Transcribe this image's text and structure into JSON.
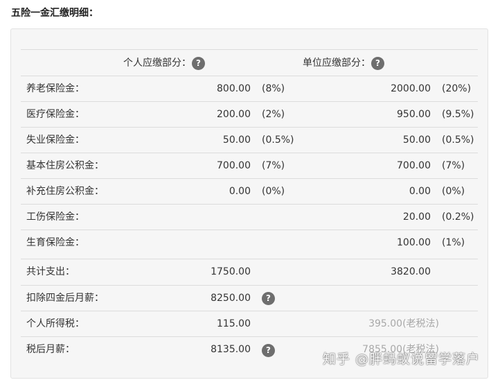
{
  "title": "五险一金汇缴明细：",
  "header": {
    "personal_label": "个人应缴部分：",
    "employer_label": "单位应缴部分：",
    "help_glyph": "?"
  },
  "rows": [
    {
      "label": "养老保险金：",
      "p_amount": "800.00",
      "p_rate": "(8%)",
      "e_amount": "2000.00",
      "e_rate": "(20%)"
    },
    {
      "label": "医疗保险金：",
      "p_amount": "200.00",
      "p_rate": "(2%)",
      "e_amount": "950.00",
      "e_rate": "(9.5%)"
    },
    {
      "label": "失业保险金：",
      "p_amount": "50.00",
      "p_rate": "(0.5%)",
      "e_amount": "50.00",
      "e_rate": "(0.5%)"
    },
    {
      "label": "基本住房公积金：",
      "p_amount": "700.00",
      "p_rate": "(7%)",
      "e_amount": "700.00",
      "e_rate": "(7%)"
    },
    {
      "label": "补充住房公积金：",
      "p_amount": "0.00",
      "p_rate": "(0%)",
      "e_amount": "0.00",
      "e_rate": "(0%)"
    },
    {
      "label": "工伤保险金：",
      "p_amount": "",
      "p_rate": "",
      "e_amount": "20.00",
      "e_rate": "(0.2%)"
    },
    {
      "label": "生育保险金：",
      "p_amount": "",
      "p_rate": "",
      "e_amount": "100.00",
      "e_rate": "(1%)"
    }
  ],
  "summary": {
    "total_label": "共计支出：",
    "total_personal": "1750.00",
    "total_employer": "3820.00",
    "after_four_label": "扣除四金后月薪：",
    "after_four_value": "8250.00",
    "income_tax_label": "个人所得税：",
    "income_tax_value": "115.00",
    "income_tax_old": "395.00(老税法)",
    "net_salary_label": "税后月薪：",
    "net_salary_value": "8135.00",
    "net_salary_old": "7855.00(老税法)"
  },
  "watermark": "知乎 @胖蚂蚁说留学落户"
}
